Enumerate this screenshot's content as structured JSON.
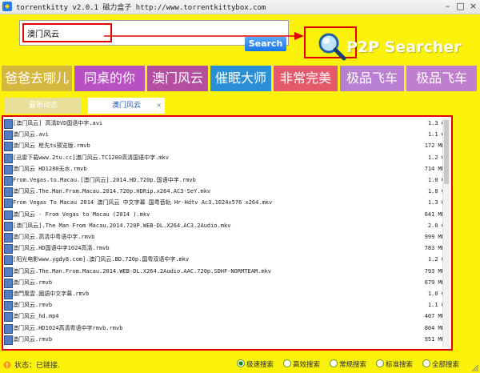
{
  "window": {
    "title": "torrentkitty v2.0.1 磁力盒子 http://www.torrentkittybox.com"
  },
  "search": {
    "value": "澳门风云",
    "button_label": "Search"
  },
  "brand": {
    "title": "P2P Searcher"
  },
  "tiles": [
    {
      "label": "爸爸去哪儿",
      "color": "#d5b63f"
    },
    {
      "label": "同桌的你",
      "color": "#b84fc2"
    },
    {
      "label": "澳门风云",
      "color": "#b44e9f"
    },
    {
      "label": "催眠大师",
      "color": "#2b8fd6"
    },
    {
      "label": "非常完美",
      "color": "#e45a6a"
    },
    {
      "label": "极品飞车",
      "color": "#b97fd0"
    },
    {
      "label": "极品飞车",
      "color": "#c07fce"
    }
  ],
  "tabs": {
    "home": "最新动态",
    "active": "澳门风云",
    "close": "×"
  },
  "results": [
    {
      "name": "[澳门风云] 高清DVD国语中字.avi",
      "size": "1.3 G"
    },
    {
      "name": "澳门风云.avi",
      "size": "1.1 G"
    },
    {
      "name": "澳门风云 枪先ts预览版.rmvb",
      "size": "172 MB"
    },
    {
      "name": "[迅雷下载www.2tu.cc]澳门风云.TC1280高清国语中字.mkv",
      "size": "1.2 G"
    },
    {
      "name": "澳门风云 HD1280无水.rmvb",
      "size": "714 MB"
    },
    {
      "name": "From.Vegas.to.Macau.[澳门风云].2014.HD.720p.国语中字.rmvb",
      "size": "1.0 G"
    },
    {
      "name": "澳门风云.The.Man.From.Macau.2014.720p.HDRip.x264.AC3-SeY.mkv",
      "size": "1.8 G"
    },
    {
      "name": "From Vegas To Macau 2014 澳门风云 中文字幕 国粤音轨 Hr-Hdtv Ac3.1024x576 x264.mkv",
      "size": "1.3 G"
    },
    {
      "name": "澳门风云 - From Vegas to Macau (2014 ).mkv",
      "size": "641 MB"
    },
    {
      "name": "[澳门风云].The Man From Macau.2014.720P.WEB-DL.X264.AC3.2Audio.mkv",
      "size": "2.0 G"
    },
    {
      "name": "澳门风云.高清中粤语中字.rmvb",
      "size": "999 MB"
    },
    {
      "name": "澳门风云.HD国语中字1024高清.rmvb",
      "size": "783 MB"
    },
    {
      "name": "[阳光电影www.ygdy8.com].澳门风云.BD.720p.国粤双语中字.mkv",
      "size": "1.2 G"
    },
    {
      "name": "澳门风云.The.Man.From.Macau.2014.WEB-DL.X264.2Audio.AAC.720p.SDHF-NORMTEAM.mkv",
      "size": "793 MB"
    },
    {
      "name": "澳门风云.rmvb",
      "size": "679 MB"
    },
    {
      "name": "澳門風雲.國語中文字幕.rmvb",
      "size": "1.0 G"
    },
    {
      "name": "澳门风云.rmvb",
      "size": "1.1 G"
    },
    {
      "name": "澳门风云_hd.mp4",
      "size": "407 MB"
    },
    {
      "name": "澳门风云.HD1024高清粤语中字rmvb.rmvb",
      "size": "804 MB"
    },
    {
      "name": "澳门风云.rmvb",
      "size": "951 MB"
    }
  ],
  "status": {
    "text": "状态：已链接."
  },
  "search_modes": [
    {
      "label": "极速搜索",
      "selected": true
    },
    {
      "label": "高效搜索",
      "selected": false
    },
    {
      "label": "常规搜索",
      "selected": false
    },
    {
      "label": "标准搜索",
      "selected": false
    },
    {
      "label": "全部搜索",
      "selected": false
    }
  ]
}
